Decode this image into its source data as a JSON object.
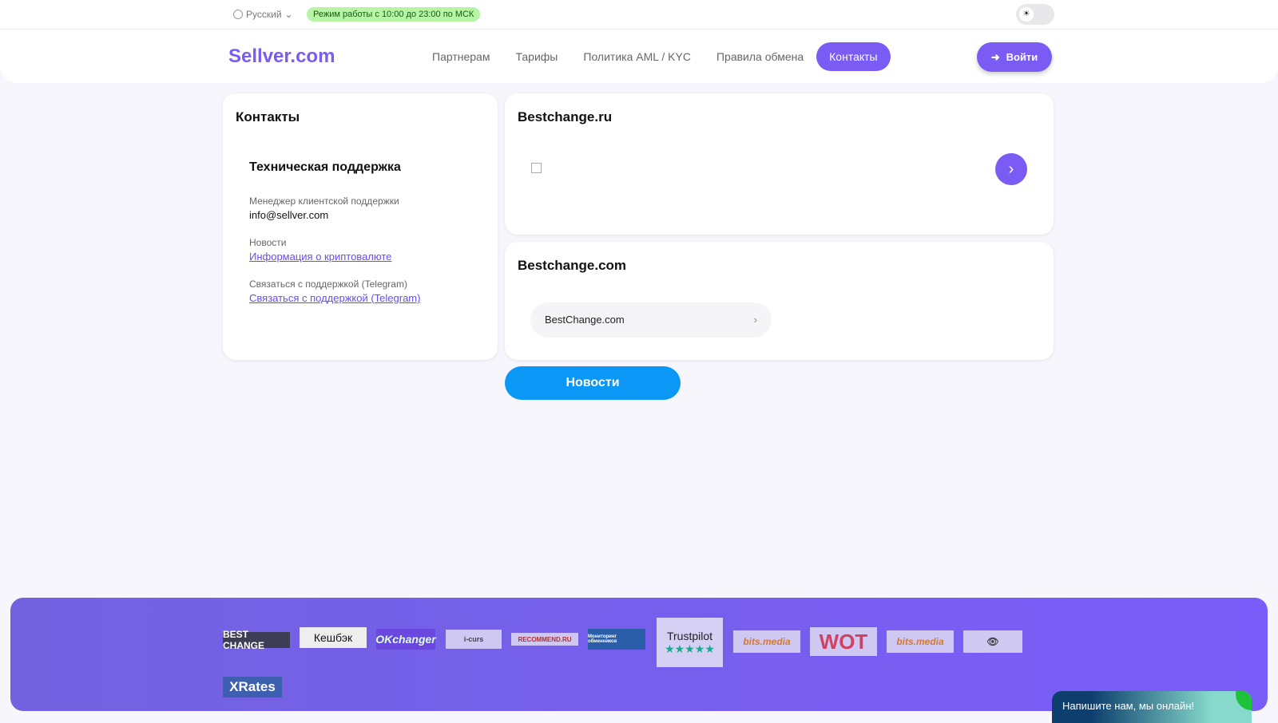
{
  "topbar": {
    "language": "Русский",
    "hours": "Режим работы с 10:00 до 23:00 по МСК"
  },
  "header": {
    "logo": "Sellver.com",
    "nav": [
      "Партнерам",
      "Тарифы",
      "Политика AML / KYC",
      "Правила обмена",
      "Контакты"
    ],
    "login": "Войти"
  },
  "contacts": {
    "title": "Контакты",
    "section": "Техническая поддержка",
    "manager_label": "Менеджер клиентской поддержки",
    "email": "info@sellver.com",
    "news_label": "Новости",
    "news_link": "Информация о криптовалюте",
    "tg_label": "Связаться с поддержкой (Telegram)",
    "tg_link": "Связаться с поддержкой (Telegram)"
  },
  "bestchange_ru": {
    "title": "Bestchange.ru"
  },
  "bestchange_com": {
    "title": "Bestchange.com",
    "button": "BestChange.com"
  },
  "news_button": "Новости",
  "footer": {
    "badges": [
      "BEST CHANGE",
      "Кешбэк",
      "OKchanger",
      "i-curs",
      "RECOMMEND.RU",
      "Мониторинг обменников",
      "Trustpilot",
      "bits.media",
      "WOT",
      "bits.media",
      "",
      "XRates"
    ]
  },
  "chat": "Напишите нам, мы онлайн!"
}
